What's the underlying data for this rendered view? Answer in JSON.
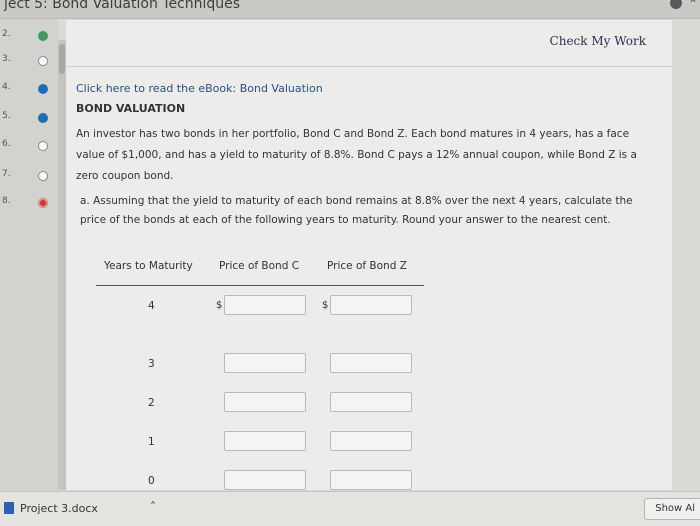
{
  "window": {
    "title": "ject 5: Bond Valuation Techniques"
  },
  "sidebar": {
    "items": [
      {
        "label": "2.",
        "status": "green"
      },
      {
        "label": "3.",
        "status": "done"
      },
      {
        "label": "4.",
        "status": "blue"
      },
      {
        "label": "5.",
        "status": "blue"
      },
      {
        "label": "6.",
        "status": "done"
      },
      {
        "label": "7.",
        "status": "done"
      },
      {
        "label": "8.",
        "status": "red"
      }
    ]
  },
  "header": {
    "check_label": "Check My Work"
  },
  "content": {
    "ebook_link": "Click here to read the eBook: Bond Valuation",
    "section_title": "BOND VALUATION",
    "problem_text": "An investor has two bonds in her portfolio, Bond C and Bond Z. Each bond matures in 4 years, has a face value of $1,000, and has a yield to maturity of 8.8%. Bond C pays a 12% annual coupon, while Bond Z is a zero coupon bond.",
    "question_text": "a. Assuming that the yield to maturity of each bond remains at 8.8% over the next 4 years, calculate the price of the bonds at each of the following years to maturity. Round your answer to the nearest cent."
  },
  "table": {
    "headers": [
      "Years to Maturity",
      "Price of Bond C",
      "Price of Bond Z"
    ],
    "rows": [
      {
        "years": "4",
        "currency": "$"
      },
      {
        "years": "3",
        "currency": ""
      },
      {
        "years": "2",
        "currency": ""
      },
      {
        "years": "1",
        "currency": ""
      },
      {
        "years": "0",
        "currency": ""
      }
    ]
  },
  "download_bar": {
    "file_name": "Project 3.docx",
    "show_all_label": "Show Al"
  }
}
